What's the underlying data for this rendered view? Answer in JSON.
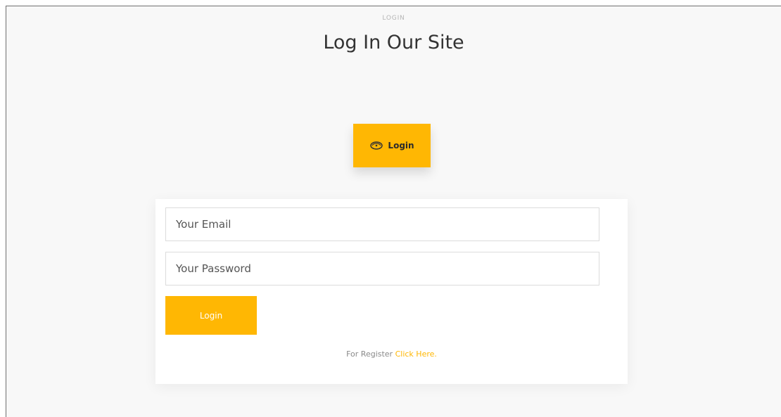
{
  "header": {
    "eyebrow": "LOGIN",
    "title": "Log In Our Site"
  },
  "hero_button": {
    "label": "Login",
    "icon": "cd-ticket-icon"
  },
  "form": {
    "email_placeholder": "Your Email",
    "password_placeholder": "Your Password",
    "submit_label": "Login"
  },
  "register": {
    "prefix": "For Register",
    "link_label": "Click Here."
  },
  "colors": {
    "accent": "#ffb703",
    "page_background": "#f8f8f8",
    "card_background": "#ffffff",
    "title_text": "#333333"
  }
}
